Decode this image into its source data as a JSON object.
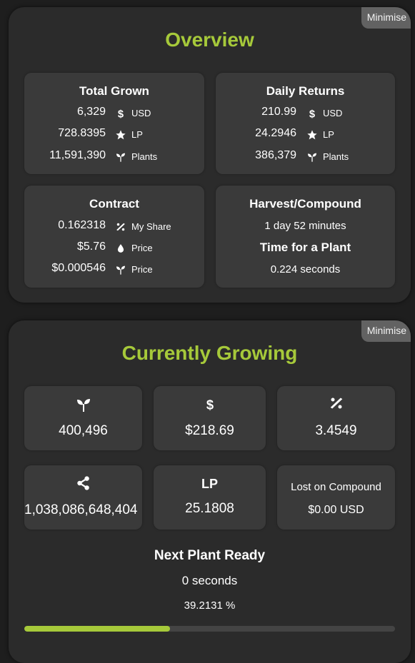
{
  "colors": {
    "accent": "#a6c93a",
    "panel": "#2b2b2b",
    "card": "#3a3a3a",
    "track": "#444444"
  },
  "overview": {
    "title": "Overview",
    "minimise_label": "Minimise",
    "total_grown": {
      "title": "Total Grown",
      "rows": [
        {
          "value": "6,329",
          "icon": "dollar-icon",
          "unit": "USD"
        },
        {
          "value": "728.8395",
          "icon": "star-icon",
          "unit": "LP"
        },
        {
          "value": "11,591,390",
          "icon": "sprout-icon",
          "unit": "Plants"
        }
      ]
    },
    "daily_returns": {
      "title": "Daily Returns",
      "rows": [
        {
          "value": "210.99",
          "icon": "dollar-icon",
          "unit": "USD"
        },
        {
          "value": "24.2946",
          "icon": "star-icon",
          "unit": "LP"
        },
        {
          "value": "386,379",
          "icon": "sprout-icon",
          "unit": "Plants"
        }
      ]
    },
    "contract": {
      "title": "Contract",
      "rows": [
        {
          "value": "0.162318",
          "icon": "percent-icon",
          "unit": "My Share"
        },
        {
          "value": "$5.76",
          "icon": "drop-icon",
          "unit": "Price"
        },
        {
          "value": "$0.000546",
          "icon": "sprout-icon",
          "unit": "Price"
        }
      ]
    },
    "harvest": {
      "title": "Harvest/Compound",
      "value": "1 day 52 minutes",
      "subtitle": "Time for a Plant",
      "subvalue": "0.224 seconds"
    }
  },
  "growing": {
    "title": "Currently Growing",
    "minimise_label": "Minimise",
    "cards": [
      {
        "icon": "sprout-icon",
        "value": "400,496"
      },
      {
        "icon": "dollar-icon",
        "value": "$218.69"
      },
      {
        "icon": "percent-icon",
        "value": "3.4549"
      },
      {
        "icon": "share-icon",
        "value": "1,038,086,648,404"
      },
      {
        "label": "LP",
        "value": "25.1808"
      },
      {
        "label": "Lost on Compound",
        "value": "$0.00 USD"
      }
    ],
    "next_plant": {
      "title": "Next Plant Ready",
      "value": "0 seconds",
      "progress_text": "39.2131 %",
      "progress_fraction": 0.392131
    }
  }
}
